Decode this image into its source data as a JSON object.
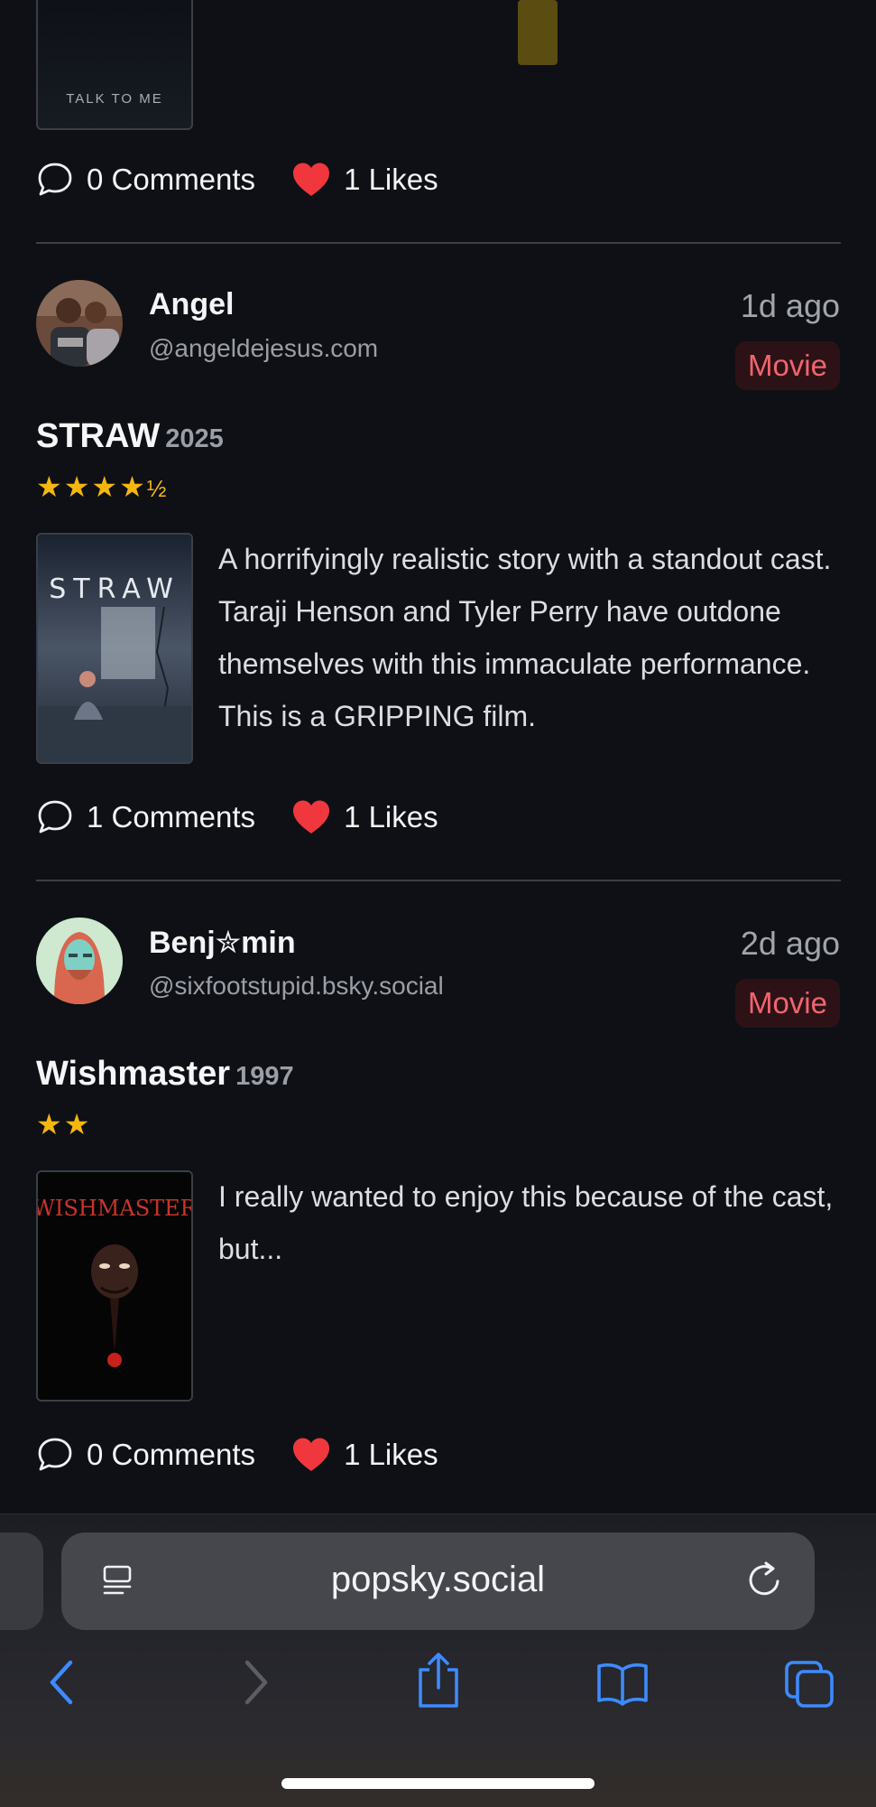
{
  "previous_post": {
    "poster_text": "TALK TO ME",
    "comments": "0 Comments",
    "likes": "1 Likes"
  },
  "posts": [
    {
      "user_name": "Angel",
      "handle": "@angeldejesus.com",
      "time": "1d ago",
      "category": "Movie",
      "title": "STRAW",
      "year": "2025",
      "rating_stars": "★★★★",
      "rating_half": "½",
      "poster_text": "STRAW",
      "review": "A horrifyingly realistic story with a standout cast. Taraji Henson and Tyler Perry have outdone themselves with this immaculate performance. This is a GRIPPING film.",
      "comments": "1 Comments",
      "likes": "1 Likes"
    },
    {
      "user_name": "Benj✮min",
      "handle": "@sixfootstupid.bsky.social",
      "time": "2d ago",
      "category": "Movie",
      "title": "Wishmaster",
      "year": "1997",
      "rating_stars": "★★",
      "rating_half": "",
      "poster_text": "WISHMASTER",
      "review": "I really wanted to enjoy this because of the cast, but...",
      "comments": "0 Comments",
      "likes": "1 Likes"
    }
  ],
  "browser": {
    "url": "popsky.social",
    "accent_color": "#3d8bff",
    "icons": [
      "reader-mode-icon",
      "reload-icon",
      "back-icon",
      "forward-icon",
      "share-icon",
      "bookmarks-icon",
      "tabs-icon"
    ]
  },
  "colors": {
    "background": "#0e1015",
    "badge_text": "#f0656f",
    "star": "#f5b70f",
    "heart": "#f0373e"
  }
}
